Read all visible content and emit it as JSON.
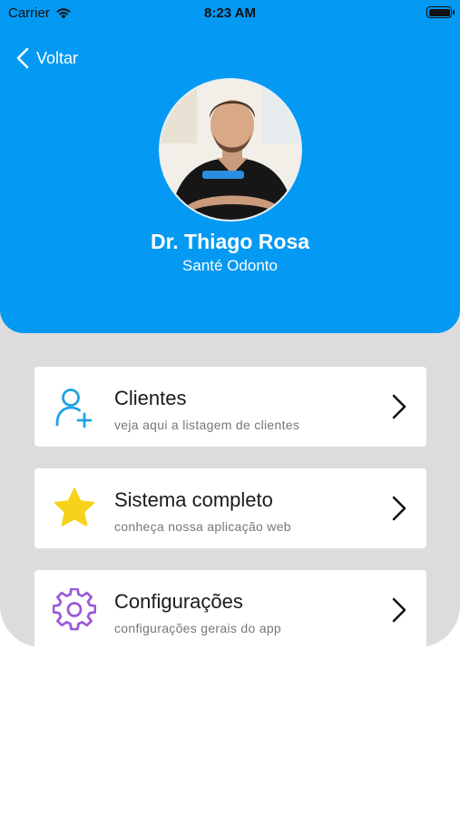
{
  "status_bar": {
    "carrier": "Carrier",
    "time": "8:23 AM"
  },
  "header": {
    "back_label": "Voltar",
    "profile": {
      "name": "Dr. Thiago Rosa",
      "company": "Santé Odonto"
    }
  },
  "menu": [
    {
      "title": "Clientes",
      "subtitle": "veja aqui a listagem de clientes",
      "icon": "user-add-icon",
      "icon_color": "#1fa2e6"
    },
    {
      "title": "Sistema completo",
      "subtitle": "conheça nossa aplicação web",
      "icon": "star-icon",
      "icon_color": "#f7d21a"
    },
    {
      "title": "Configurações",
      "subtitle": "configurações gerais do app",
      "icon": "gear-icon",
      "icon_color": "#9b59d9"
    }
  ],
  "colors": {
    "header_bg": "#0499f2",
    "panel_bg": "#dcdcdc"
  }
}
